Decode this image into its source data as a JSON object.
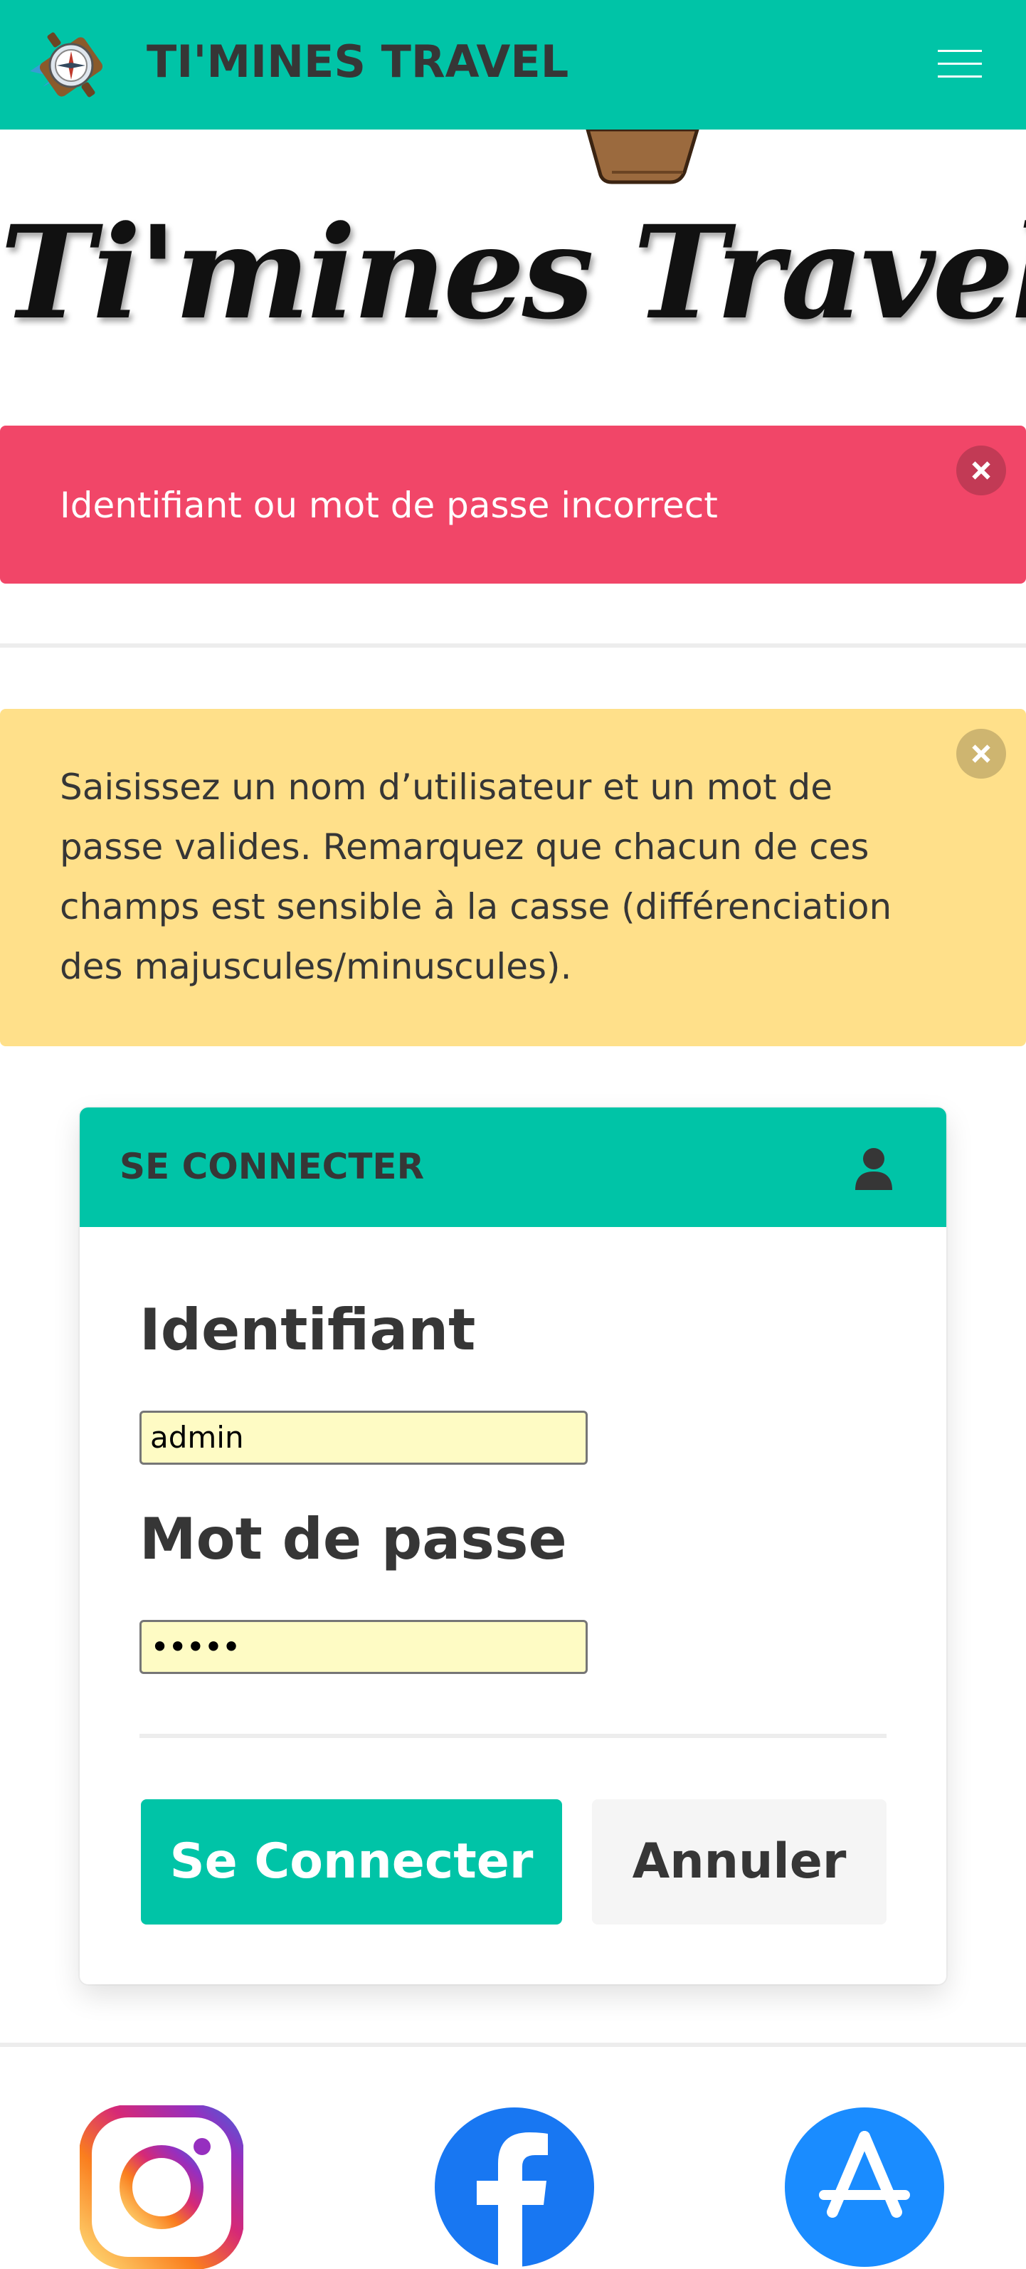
{
  "navbar": {
    "title": "TI'MINES TRAVEL",
    "menu_icon": "hamburger-menu-icon",
    "logo_icon": "suitcase-compass-logo"
  },
  "hero": {
    "brand_text": "Ti'mines Travel"
  },
  "alerts": {
    "error_text": "Identifiant ou mot de passe incorrect",
    "warning_text": "Saisissez un nom d’utilisateur et un mot de passe valides. Remarquez que chacun de ces champs est sensible à la casse (différenciation des majuscules/minuscules)."
  },
  "login": {
    "header_title": "SE CONNECTER",
    "header_icon": "user-icon",
    "username_label": "Identifiant",
    "username_value": "admin",
    "password_label": "Mot de passe",
    "password_value": "•••••",
    "submit_label": "Se Connecter",
    "cancel_label": "Annuler"
  },
  "footer": {
    "social_icons": [
      "instagram-icon",
      "facebook-icon",
      "app-store-icon"
    ]
  },
  "colors": {
    "primary": "#00c4a7",
    "danger": "#f14668",
    "warning": "#ffe08a",
    "autofill": "#fefbc4",
    "text_dark": "#363636"
  }
}
